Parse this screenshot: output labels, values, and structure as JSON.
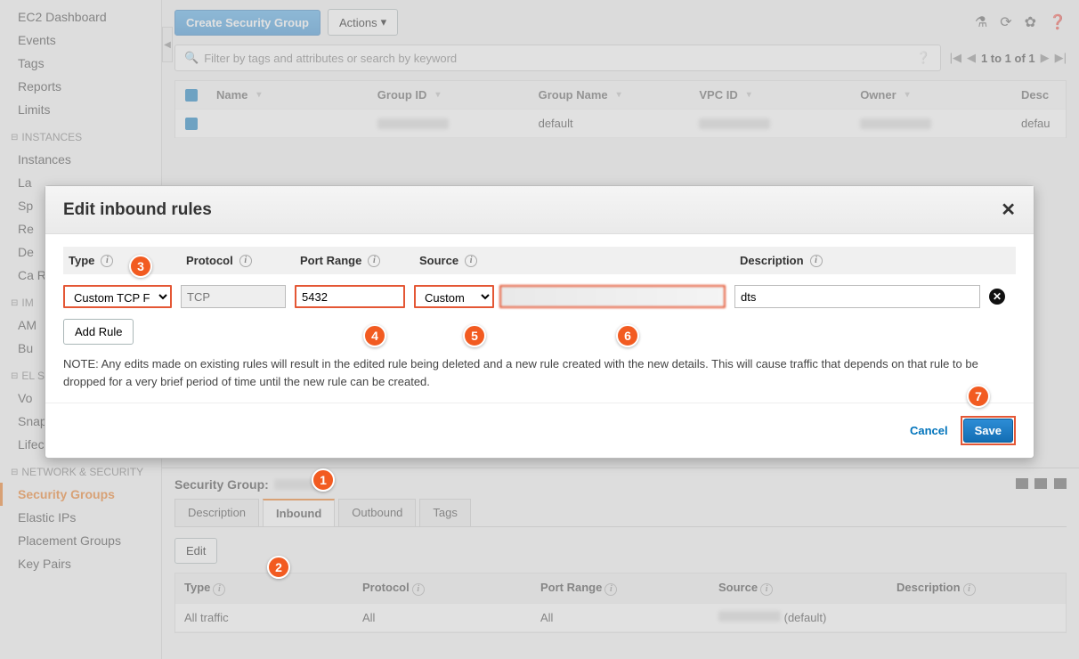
{
  "sidebar": {
    "top": [
      "EC2 Dashboard",
      "Events",
      "Tags",
      "Reports",
      "Limits"
    ],
    "sections": [
      {
        "title": "INSTANCES",
        "items": [
          "Instances",
          "La",
          "Sp",
          "Re",
          "De",
          "Ca Re"
        ]
      },
      {
        "title": "IM",
        "items": [
          "AM",
          "Bu"
        ]
      },
      {
        "title": "EL ST",
        "items": [
          "Vo",
          "Snapshots",
          "Lifecycle Manager"
        ]
      },
      {
        "title": "NETWORK & SECURITY",
        "items": [
          "Security Groups",
          "Elastic IPs",
          "Placement Groups",
          "Key Pairs"
        ]
      }
    ],
    "active": "Security Groups"
  },
  "topbar": {
    "create_btn": "Create Security Group",
    "actions_btn": "Actions"
  },
  "search_placeholder": "Filter by tags and attributes or search by keyword",
  "pager_text": "1 to 1 of 1",
  "table": {
    "cols": [
      "Name",
      "Group ID",
      "Group Name",
      "VPC ID",
      "Owner",
      "Desc"
    ],
    "row": {
      "group_name": "default",
      "desc": "defau"
    }
  },
  "bottom": {
    "title_prefix": "Security Group:",
    "tabs": [
      "Description",
      "Inbound",
      "Outbound",
      "Tags"
    ],
    "active_tab": "Inbound",
    "edit_btn": "Edit",
    "rules_cols": [
      "Type",
      "Protocol",
      "Port Range",
      "Source",
      "Description"
    ],
    "rule_row": {
      "type": "All traffic",
      "protocol": "All",
      "port_range": "All",
      "source_suffix": "(default)"
    }
  },
  "modal": {
    "title": "Edit inbound rules",
    "cols": [
      "Type",
      "Protocol",
      "Port Range",
      "Source",
      "Description"
    ],
    "rule": {
      "type": "Custom TCP F",
      "protocol": "TCP",
      "port": "5432",
      "source_type": "Custom",
      "source_value": "",
      "description": "dts"
    },
    "add_rule_btn": "Add Rule",
    "note": "NOTE: Any edits made on existing rules will result in the edited rule being deleted and a new rule created with the new details. This will cause traffic that depends on that rule to be dropped for a very brief period of time until the new rule can be created.",
    "cancel": "Cancel",
    "save": "Save"
  },
  "annotations": [
    "1",
    "2",
    "3",
    "4",
    "5",
    "6",
    "7"
  ]
}
